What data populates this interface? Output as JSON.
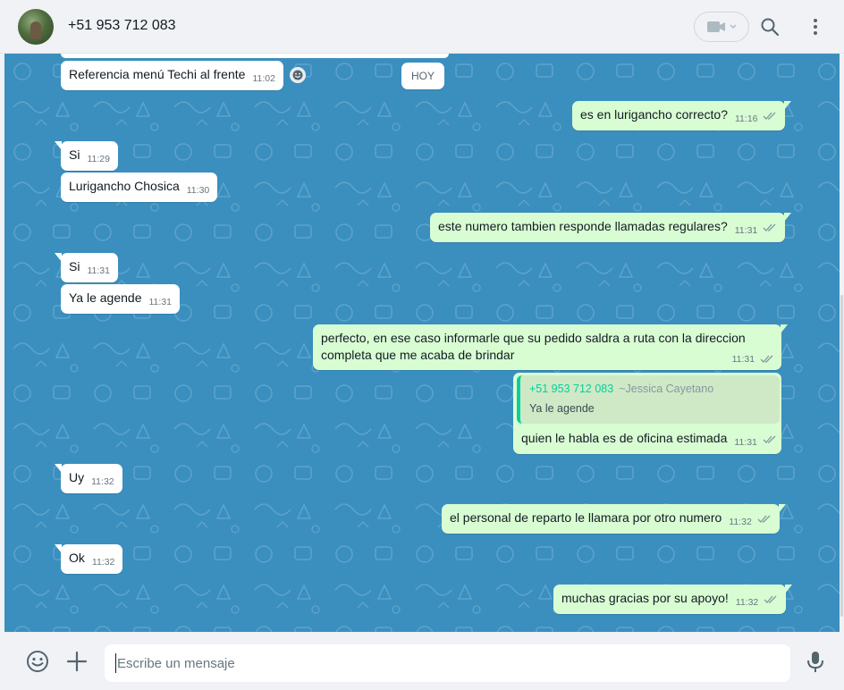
{
  "header": {
    "contact_name": "+51 953 712 083"
  },
  "date_chip": "HOY",
  "messages": [
    {
      "dir": "in",
      "text": "Referencia menú Techi al frente",
      "time": "11:02"
    },
    {
      "dir": "out",
      "text": "es en lurigancho correcto?",
      "time": "11:16"
    },
    {
      "dir": "in",
      "text": "Si",
      "time": "11:29"
    },
    {
      "dir": "in",
      "text": "Lurigancho Chosica",
      "time": "11:30"
    },
    {
      "dir": "out",
      "text": "este numero tambien responde llamadas regulares?",
      "time": "11:31"
    },
    {
      "dir": "in",
      "text": "Si",
      "time": "11:31"
    },
    {
      "dir": "in",
      "text": "Ya le agende",
      "time": "11:31"
    },
    {
      "dir": "out",
      "text": "perfecto, en ese caso informarle que su pedido saldra a ruta con la direccion",
      "text2": "completa que me acaba de brindar",
      "time": "11:31"
    },
    {
      "dir": "out",
      "text": "quien le habla es de oficina estimada",
      "time": "11:31",
      "quote": {
        "name": "+51 953 712 083",
        "alias": "~Jessica Cayetano",
        "text": "Ya le agende"
      }
    },
    {
      "dir": "in",
      "text": "Uy",
      "time": "11:32"
    },
    {
      "dir": "out",
      "text": "el personal de reparto le llamara por otro numero",
      "time": "11:32"
    },
    {
      "dir": "in",
      "text": "Ok",
      "time": "11:32"
    },
    {
      "dir": "out",
      "text": "muchas gracias por su apoyo!",
      "time": "11:32"
    }
  ],
  "composer": {
    "placeholder": "Escribe un mensaje"
  },
  "colors": {
    "chat_bg": "#3a8fbf",
    "incoming": "#ffffff",
    "outgoing": "#d9fdd3",
    "accent": "#06cf9c"
  }
}
